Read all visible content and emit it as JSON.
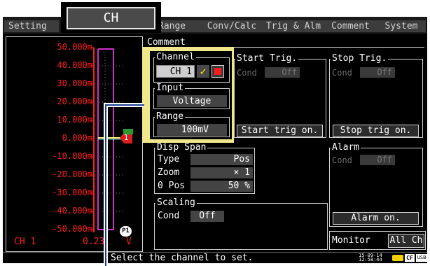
{
  "tabs": [
    "Setting",
    "Range",
    "Conv/Calc",
    "Trig & Alm",
    "Comment",
    "System"
  ],
  "popup_title": "CH",
  "comment_label": "Comment",
  "channel": {
    "legend": "Channel",
    "value": "CH 1",
    "check_icon": "checkmark-icon",
    "color": "#ff1a1a"
  },
  "input": {
    "legend": "Input",
    "value": "Voltage"
  },
  "range": {
    "legend": "Range",
    "value": "100mV"
  },
  "start_trig": {
    "legend": "Start Trig.",
    "cond_label": "Cond",
    "cond_value": "Off",
    "button": "Start trig on."
  },
  "stop_trig": {
    "legend": "Stop Trig.",
    "cond_label": "Cond",
    "cond_value": "Off",
    "button": "Stop trig on."
  },
  "disp_span": {
    "legend": "Disp Span",
    "type_label": "Type",
    "type_value": "Pos",
    "zoom_label": "Zoom",
    "zoom_value": "× 1",
    "pos_label": "0 Pos",
    "pos_value": "50 %"
  },
  "alarm": {
    "legend": "Alarm",
    "cond_label": "Cond",
    "cond_value": "Off",
    "button": "Alarm on."
  },
  "scaling": {
    "legend": "Scaling",
    "cond_label": "Cond",
    "cond_value": "Off"
  },
  "monitor": {
    "label": "Monitor",
    "value": "All Ch"
  },
  "graph": {
    "y_labels": [
      "50.000m",
      "40.000m",
      "30.000m",
      "20.000m",
      "10.000m",
      "0.000m",
      "-10.000m",
      "-20.000m",
      "-30.000m",
      "-40.000m",
      "-50.000m"
    ],
    "channel_label": "CH 1",
    "reading": "0.23",
    "reading_unit": "V",
    "marker": "1",
    "trigger_marker": "P1"
  },
  "status": {
    "message": "Select the channel to set.",
    "date": "15-09-14",
    "time": "12:58:44",
    "cf_label": "CF",
    "usb_label": "USB"
  },
  "colors": {
    "accent": "#f0e68c",
    "graph_axis": "#ff2020",
    "trace": "#cc33cc"
  }
}
